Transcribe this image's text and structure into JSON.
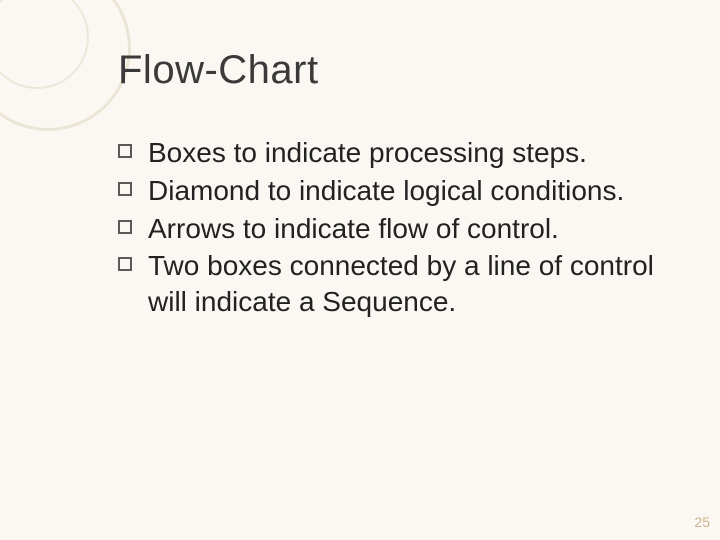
{
  "slide": {
    "title": "Flow-Chart",
    "bullets": [
      "Boxes to indicate processing steps.",
      "Diamond to indicate logical conditions.",
      "Arrows to indicate flow of control.",
      "Two boxes connected by a line of control will indicate a Sequence."
    ],
    "page_number": "25"
  }
}
